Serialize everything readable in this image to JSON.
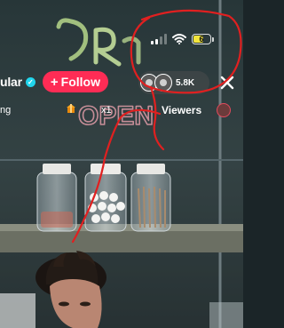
{
  "status_bar": {
    "battery_level": "6",
    "battery_color": "#f2e53c"
  },
  "header": {
    "host_name_partial": "ular",
    "verified_icon": "verified-badge-icon",
    "follow_button": {
      "plus": "+",
      "label": "Follow",
      "color": "#fe2c55"
    },
    "viewer_count": "5.8K",
    "close_icon": "close-icon"
  },
  "subbar": {
    "left_partial": "ng",
    "multiplier": "x1",
    "viewers_label": "Viewers"
  },
  "annotation": {
    "color": "#e02020",
    "description_icon": "hand-drawn-circle-annotation"
  },
  "neon_sign_text": "OPEN"
}
